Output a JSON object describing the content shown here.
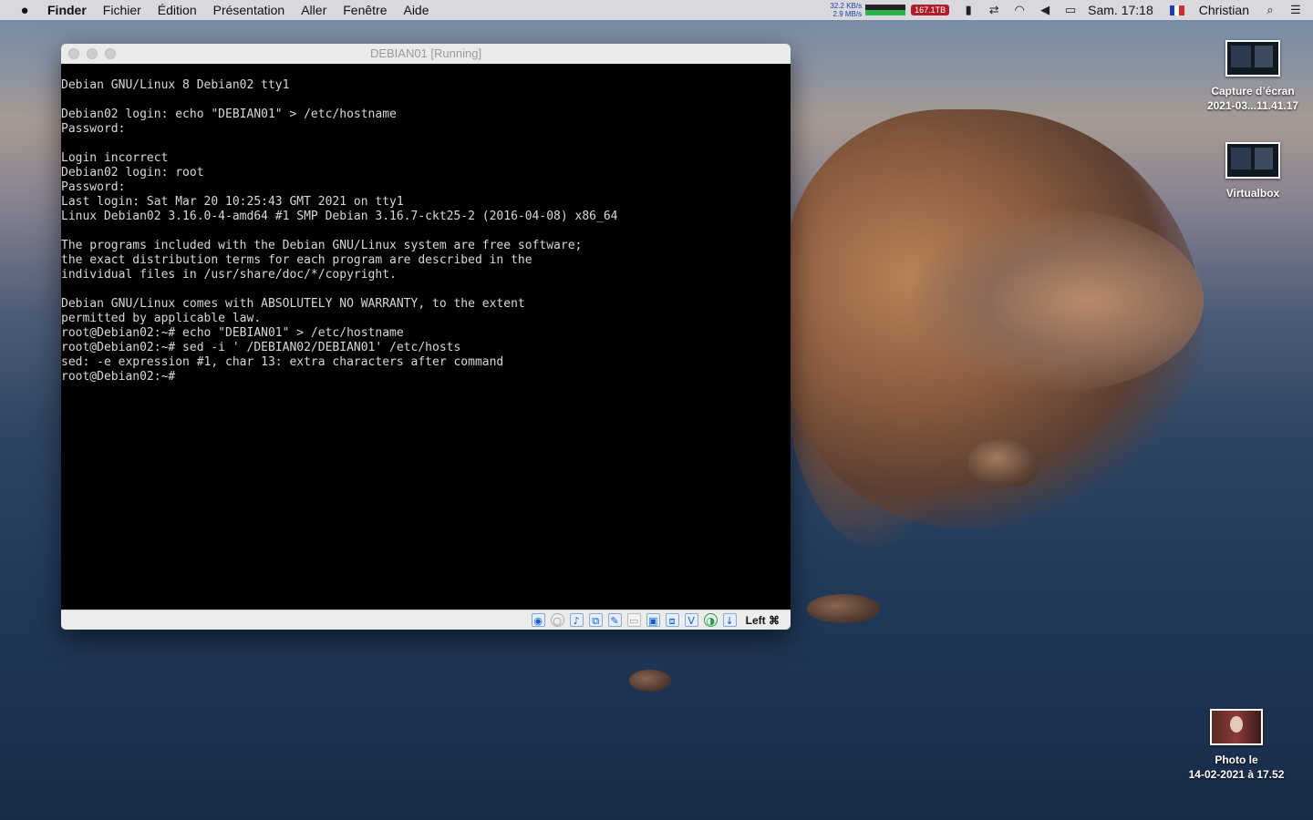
{
  "menubar": {
    "apple_icon": "",
    "items": [
      "Finder",
      "Fichier",
      "Édition",
      "Présentation",
      "Aller",
      "Fenêtre",
      "Aide"
    ]
  },
  "status": {
    "net_up": "32.2 KB/s",
    "net_down": "2.9 MB/s",
    "disk": "167.1TB",
    "clock": "Sam. 17:18",
    "user": "Christian"
  },
  "vm": {
    "title": "DEBIAN01 [Running]",
    "console_lines": [
      "Debian GNU/Linux 8 Debian02 tty1",
      "",
      "Debian02 login: echo \"DEBIAN01\" > /etc/hostname",
      "Password:",
      "",
      "Login incorrect",
      "Debian02 login: root",
      "Password:",
      "Last login: Sat Mar 20 10:25:43 GMT 2021 on tty1",
      "Linux Debian02 3.16.0-4-amd64 #1 SMP Debian 3.16.7-ckt25-2 (2016-04-08) x86_64",
      "",
      "The programs included with the Debian GNU/Linux system are free software;",
      "the exact distribution terms for each program are described in the",
      "individual files in /usr/share/doc/*/copyright.",
      "",
      "Debian GNU/Linux comes with ABSOLUTELY NO WARRANTY, to the extent",
      "permitted by applicable law.",
      "root@Debian02:~# echo \"DEBIAN01\" > /etc/hostname",
      "root@Debian02:~# sed -i ' /DEBIAN02/DEBIAN01' /etc/hosts",
      "sed: -e expression #1, char 13: extra characters after command",
      "root@Debian02:~#"
    ],
    "host_key": "Left ⌘"
  },
  "desktop": {
    "icon1_line1": "Capture d’écran",
    "icon1_line2": "2021-03...11.41.17",
    "icon2_label": "Virtualbox",
    "icon3_line1": "Photo le",
    "icon3_line2": "14-02-2021 à 17.52"
  }
}
